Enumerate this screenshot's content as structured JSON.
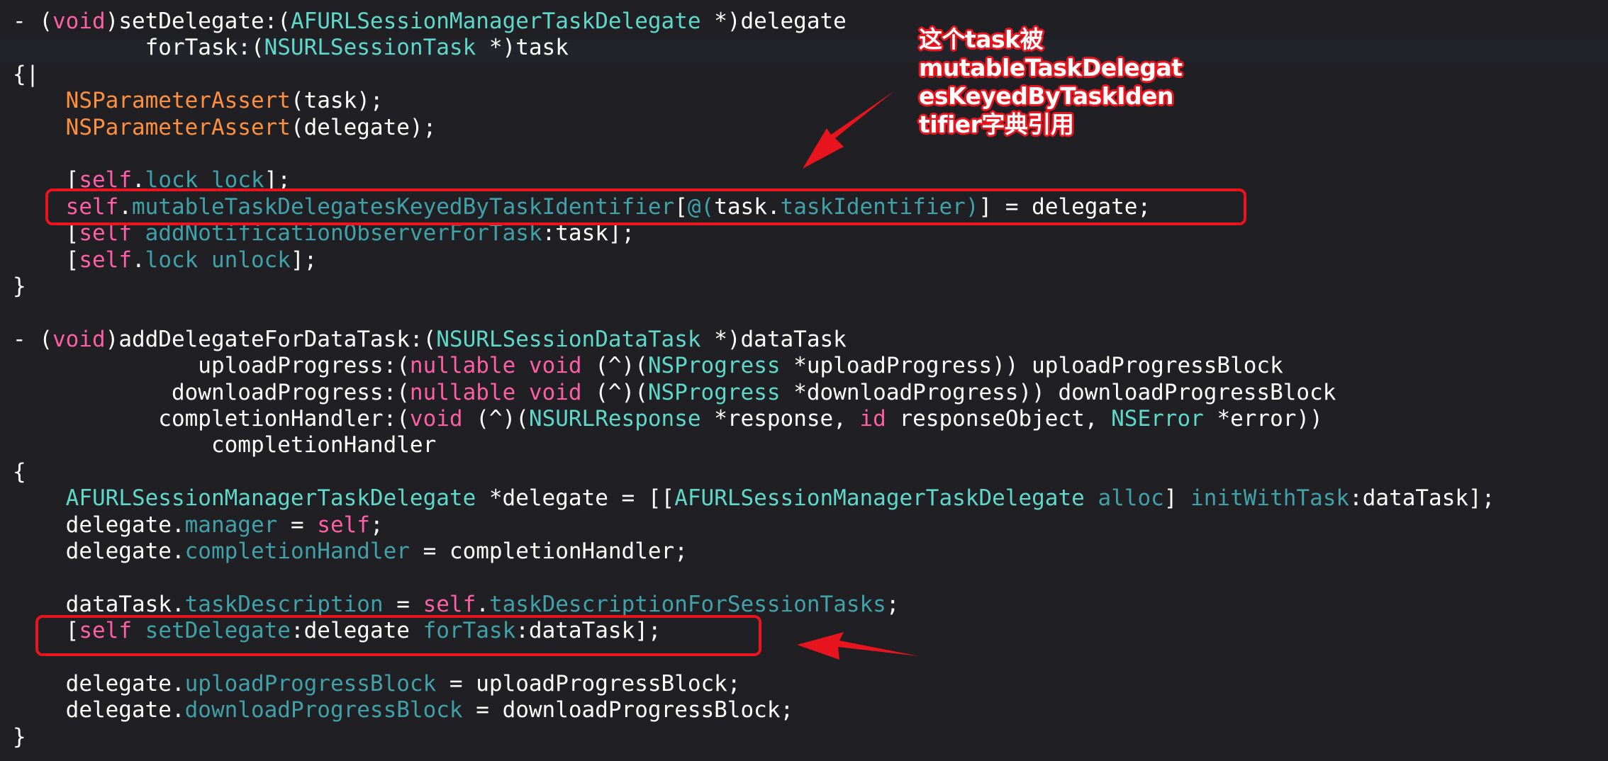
{
  "editor": {
    "background": "#1f1f24",
    "syntax_colors": {
      "keyword": "#fc5fa3",
      "type": "#5dd8c9",
      "method": "#41a1a8",
      "macro": "#fd8f3f",
      "plain": "#ffffff"
    },
    "lines": [
      [
        {
          "t": "- (",
          "c": "pl"
        },
        {
          "t": "void",
          "c": "kw"
        },
        {
          "t": ")setDelegate:(",
          "c": "pl"
        },
        {
          "t": "AFURLSessionManagerTaskDelegate",
          "c": "ty"
        },
        {
          "t": " *)delegate",
          "c": "pl"
        }
      ],
      [
        {
          "t": "          forTask:(",
          "c": "pl"
        },
        {
          "t": "NSURLSessionTask",
          "c": "ty"
        },
        {
          "t": " *)task",
          "c": "pl"
        }
      ],
      [
        {
          "t": "{|",
          "c": "pl"
        }
      ],
      [
        {
          "t": "    ",
          "c": "pl"
        },
        {
          "t": "NSParameterAssert",
          "c": "mac"
        },
        {
          "t": "(task);",
          "c": "pl"
        }
      ],
      [
        {
          "t": "    ",
          "c": "pl"
        },
        {
          "t": "NSParameterAssert",
          "c": "mac"
        },
        {
          "t": "(delegate);",
          "c": "pl"
        }
      ],
      [],
      [
        {
          "t": "    [",
          "c": "pl"
        },
        {
          "t": "self",
          "c": "kw"
        },
        {
          "t": ".",
          "c": "pl"
        },
        {
          "t": "lock",
          "c": "me"
        },
        {
          "t": " ",
          "c": "pl"
        },
        {
          "t": "lock",
          "c": "me"
        },
        {
          "t": "];",
          "c": "pl"
        }
      ],
      [
        {
          "t": "    ",
          "c": "pl"
        },
        {
          "t": "self",
          "c": "kw"
        },
        {
          "t": ".",
          "c": "pl"
        },
        {
          "t": "mutableTaskDelegatesKeyedByTaskIdentifier",
          "c": "me"
        },
        {
          "t": "[",
          "c": "pl"
        },
        {
          "t": "@(",
          "c": "me"
        },
        {
          "t": "task.",
          "c": "pl"
        },
        {
          "t": "taskIdentifier",
          "c": "me"
        },
        {
          "t": ")",
          "c": "me"
        },
        {
          "t": "] = delegate;",
          "c": "pl"
        }
      ],
      [
        {
          "t": "    [",
          "c": "pl"
        },
        {
          "t": "self",
          "c": "kw"
        },
        {
          "t": " ",
          "c": "pl"
        },
        {
          "t": "addNotificationObserverForTask",
          "c": "me"
        },
        {
          "t": ":task];",
          "c": "pl"
        }
      ],
      [
        {
          "t": "    [",
          "c": "pl"
        },
        {
          "t": "self",
          "c": "kw"
        },
        {
          "t": ".",
          "c": "pl"
        },
        {
          "t": "lock",
          "c": "me"
        },
        {
          "t": " ",
          "c": "pl"
        },
        {
          "t": "unlock",
          "c": "me"
        },
        {
          "t": "];",
          "c": "pl"
        }
      ],
      [
        {
          "t": "}",
          "c": "pl"
        }
      ],
      [],
      [
        {
          "t": "- (",
          "c": "pl"
        },
        {
          "t": "void",
          "c": "kw"
        },
        {
          "t": ")addDelegateForDataTask:(",
          "c": "pl"
        },
        {
          "t": "NSURLSessionDataTask",
          "c": "ty"
        },
        {
          "t": " *)dataTask",
          "c": "pl"
        }
      ],
      [
        {
          "t": "              uploadProgress:(",
          "c": "pl"
        },
        {
          "t": "nullable",
          "c": "kw"
        },
        {
          "t": " ",
          "c": "pl"
        },
        {
          "t": "void",
          "c": "kw"
        },
        {
          "t": " (^)(",
          "c": "pl"
        },
        {
          "t": "NSProgress",
          "c": "ty"
        },
        {
          "t": " *uploadProgress)) uploadProgressBlock",
          "c": "pl"
        }
      ],
      [
        {
          "t": "            downloadProgress:(",
          "c": "pl"
        },
        {
          "t": "nullable",
          "c": "kw"
        },
        {
          "t": " ",
          "c": "pl"
        },
        {
          "t": "void",
          "c": "kw"
        },
        {
          "t": " (^)(",
          "c": "pl"
        },
        {
          "t": "NSProgress",
          "c": "ty"
        },
        {
          "t": " *downloadProgress)) downloadProgressBlock",
          "c": "pl"
        }
      ],
      [
        {
          "t": "           completionHandler:(",
          "c": "pl"
        },
        {
          "t": "void",
          "c": "kw"
        },
        {
          "t": " (^)(",
          "c": "pl"
        },
        {
          "t": "NSURLResponse",
          "c": "ty"
        },
        {
          "t": " *response, ",
          "c": "pl"
        },
        {
          "t": "id",
          "c": "kw"
        },
        {
          "t": " responseObject, ",
          "c": "pl"
        },
        {
          "t": "NSError",
          "c": "ty"
        },
        {
          "t": " *error))",
          "c": "pl"
        }
      ],
      [
        {
          "t": "               completionHandler",
          "c": "pl"
        }
      ],
      [
        {
          "t": "{",
          "c": "pl"
        }
      ],
      [
        {
          "t": "    ",
          "c": "pl"
        },
        {
          "t": "AFURLSessionManagerTaskDelegate",
          "c": "ty"
        },
        {
          "t": " *delegate = [[",
          "c": "pl"
        },
        {
          "t": "AFURLSessionManagerTaskDelegate",
          "c": "ty"
        },
        {
          "t": " ",
          "c": "pl"
        },
        {
          "t": "alloc",
          "c": "me"
        },
        {
          "t": "] ",
          "c": "pl"
        },
        {
          "t": "initWithTask",
          "c": "me"
        },
        {
          "t": ":dataTask];",
          "c": "pl"
        }
      ],
      [
        {
          "t": "    delegate.",
          "c": "pl"
        },
        {
          "t": "manager",
          "c": "me"
        },
        {
          "t": " = ",
          "c": "pl"
        },
        {
          "t": "self",
          "c": "kw"
        },
        {
          "t": ";",
          "c": "pl"
        }
      ],
      [
        {
          "t": "    delegate.",
          "c": "pl"
        },
        {
          "t": "completionHandler",
          "c": "me"
        },
        {
          "t": " = completionHandler;",
          "c": "pl"
        }
      ],
      [],
      [
        {
          "t": "    dataTask.",
          "c": "pl"
        },
        {
          "t": "taskDescription",
          "c": "me"
        },
        {
          "t": " = ",
          "c": "pl"
        },
        {
          "t": "self",
          "c": "kw"
        },
        {
          "t": ".",
          "c": "pl"
        },
        {
          "t": "taskDescriptionForSessionTasks",
          "c": "me"
        },
        {
          "t": ";",
          "c": "pl"
        }
      ],
      [
        {
          "t": "    [",
          "c": "pl"
        },
        {
          "t": "self",
          "c": "kw"
        },
        {
          "t": " ",
          "c": "pl"
        },
        {
          "t": "setDelegate",
          "c": "me"
        },
        {
          "t": ":delegate ",
          "c": "pl"
        },
        {
          "t": "forTask",
          "c": "me"
        },
        {
          "t": ":dataTask];",
          "c": "pl"
        }
      ],
      [],
      [
        {
          "t": "    delegate.",
          "c": "pl"
        },
        {
          "t": "uploadProgressBlock",
          "c": "me"
        },
        {
          "t": " = uploadProgressBlock;",
          "c": "pl"
        }
      ],
      [
        {
          "t": "    delegate.",
          "c": "pl"
        },
        {
          "t": "downloadProgressBlock",
          "c": "me"
        },
        {
          "t": " = downloadProgressBlock;",
          "c": "pl"
        }
      ],
      [
        {
          "t": "}",
          "c": "pl"
        }
      ]
    ]
  },
  "annotation": {
    "color": "#e8151f",
    "lines": [
      "这个task被",
      "mutableTaskDelegat",
      "esKeyedByTaskIden",
      "tifier字典引用"
    ]
  }
}
